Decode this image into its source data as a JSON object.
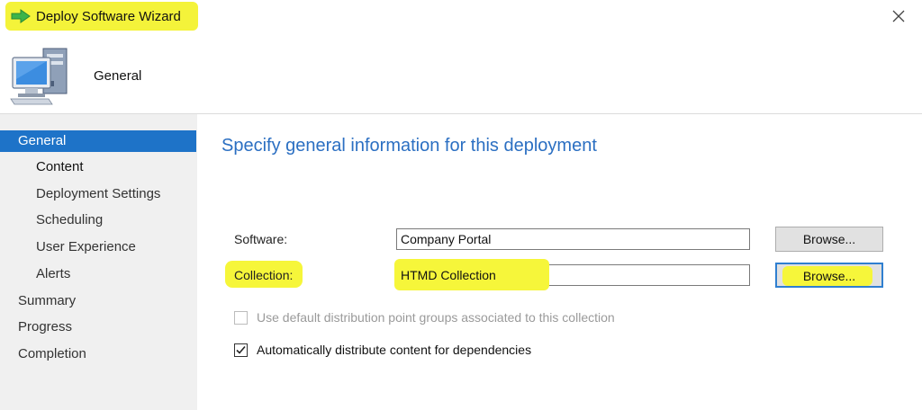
{
  "window": {
    "title": "Deploy Software Wizard",
    "close_glyph": "✕"
  },
  "header": {
    "title": "General"
  },
  "nav": {
    "items": [
      {
        "label": "General",
        "selected": true,
        "level": 0
      },
      {
        "label": "Content",
        "level": 1,
        "bold": true
      },
      {
        "label": "Deployment Settings",
        "level": 1
      },
      {
        "label": "Scheduling",
        "level": 1
      },
      {
        "label": "User Experience",
        "level": 1
      },
      {
        "label": "Alerts",
        "level": 1
      },
      {
        "label": "Summary",
        "level": 0
      },
      {
        "label": "Progress",
        "level": 0
      },
      {
        "label": "Completion",
        "level": 0
      }
    ]
  },
  "main": {
    "heading": "Specify general information for this deployment",
    "software": {
      "label": "Software:",
      "value": "Company Portal",
      "browse_label": "Browse..."
    },
    "collection": {
      "label": "Collection:",
      "value": "HTMD Collection",
      "browse_label": "Browse..."
    },
    "checkboxes": [
      {
        "label": "Use default distribution point groups associated to this collection",
        "checked": false,
        "disabled": true
      },
      {
        "label": "Automatically distribute content for dependencies",
        "checked": true,
        "disabled": false
      }
    ]
  },
  "colors": {
    "accent": "#1e73c8",
    "heading": "#2b6fc2",
    "highlight": "#f4f33a",
    "nav_bg": "#f0f0f0"
  },
  "icons": {
    "title": "green-arrow-icon",
    "header": "computer-icon",
    "close": "close-icon"
  }
}
